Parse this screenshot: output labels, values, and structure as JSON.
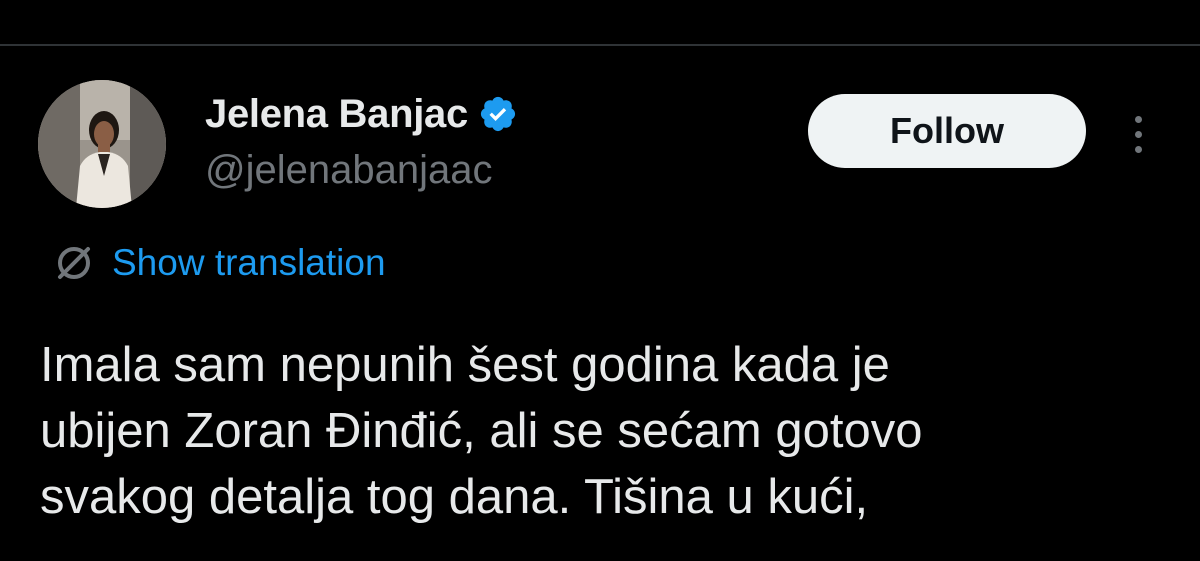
{
  "author": {
    "display_name": "Jelena Banjac",
    "handle": "@jelenabanjaac",
    "verified": true,
    "avatar_icon": "profile-photo"
  },
  "actions": {
    "follow_label": "Follow",
    "more_icon": "more-vertical-icon"
  },
  "translation": {
    "icon": "translate-globe-icon",
    "label": "Show translation"
  },
  "tweet": {
    "lines": [
      "Imala sam nepunih šest godina kada je",
      "ubijen Zoran Đinđić, ali se sećam gotovo",
      "svakog detalja tog dana. Tišina u kući,"
    ]
  },
  "colors": {
    "background": "#000000",
    "text_primary": "#e7e9ea",
    "text_secondary": "#71767b",
    "accent_blue": "#1d9bf0",
    "follow_button_bg": "#eff3f4",
    "divider": "#2f3336"
  }
}
